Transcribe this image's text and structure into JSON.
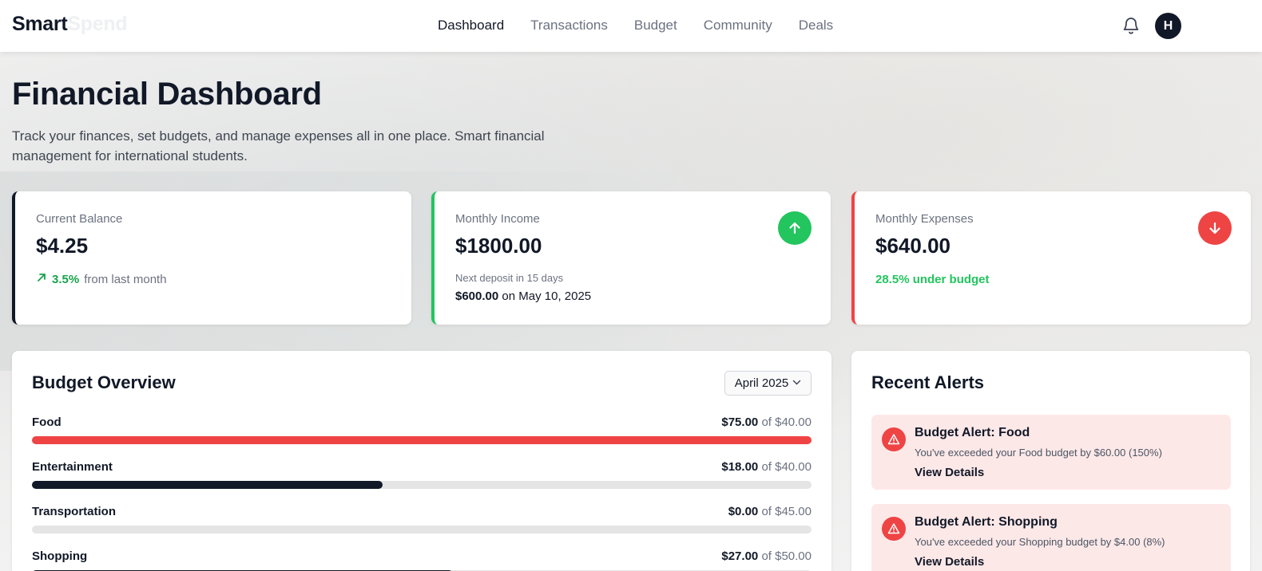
{
  "header": {
    "logo_part1": "Smart",
    "logo_part2": "Spend",
    "nav": [
      {
        "label": "Dashboard",
        "active": true
      },
      {
        "label": "Transactions",
        "active": false
      },
      {
        "label": "Budget",
        "active": false
      },
      {
        "label": "Community",
        "active": false
      },
      {
        "label": "Deals",
        "active": false
      }
    ],
    "bell_icon": "bell-icon",
    "avatar_initial": "H"
  },
  "page": {
    "title": "Financial Dashboard",
    "description": "Track your finances, set budgets, and manage expenses all in one place. Smart financial management for international students."
  },
  "stats": {
    "balance": {
      "label": "Current Balance",
      "value": "$4.25",
      "trend_pct": "3.5%",
      "trend_text": "from last month",
      "trend_icon": "arrow-up-right-icon"
    },
    "income": {
      "label": "Monthly Income",
      "value": "$1800.00",
      "next_label": "Next deposit in 15 days",
      "next_amount": "$600.00",
      "next_date": "on May 10, 2025",
      "icon": "arrow-up-icon"
    },
    "expenses": {
      "label": "Monthly Expenses",
      "value": "$640.00",
      "status": "28.5% under budget",
      "icon": "arrow-down-icon"
    }
  },
  "budget": {
    "title": "Budget Overview",
    "month": "April 2025",
    "items": [
      {
        "name": "Food",
        "spent": "$75.00",
        "limit": "of $40.00",
        "progress": 1.0,
        "color": "#ef4444"
      },
      {
        "name": "Entertainment",
        "spent": "$18.00",
        "limit": "of $40.00",
        "progress": 0.45,
        "color": "#111827"
      },
      {
        "name": "Transportation",
        "spent": "$0.00",
        "limit": "of $45.00",
        "progress": 0.0,
        "color": "#111827"
      },
      {
        "name": "Shopping",
        "spent": "$27.00",
        "limit": "of $50.00",
        "progress": 0.54,
        "color": "#111827"
      }
    ]
  },
  "alerts": {
    "title": "Recent Alerts",
    "items": [
      {
        "title": "Budget Alert: Food",
        "message": "You've exceeded your Food budget by $60.00 (150%)",
        "link": "View Details"
      },
      {
        "title": "Budget Alert: Shopping",
        "message": "You've exceeded your Shopping budget by $4.00 (8%)",
        "link": "View Details"
      }
    ]
  },
  "colors": {
    "primary": "#111827",
    "success": "#22c55e",
    "danger": "#ef4444",
    "alert_bg": "#fde8e8"
  }
}
